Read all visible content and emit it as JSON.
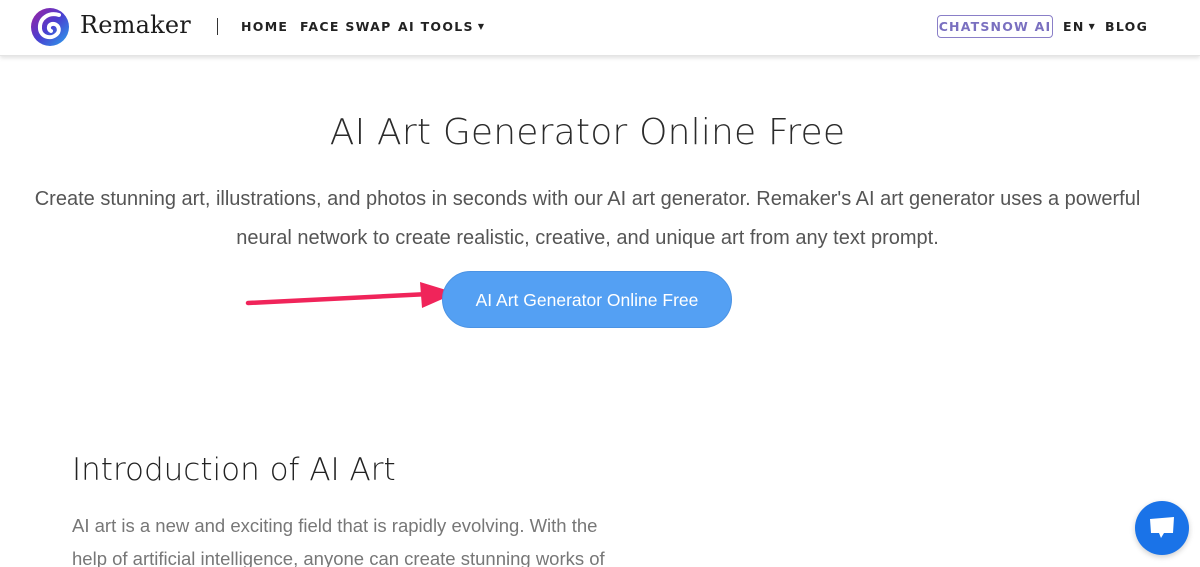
{
  "header": {
    "brand": "Remaker",
    "logo_icon": "remaker-swirl-logo",
    "nav": [
      {
        "label": "HOME"
      },
      {
        "label": "FACE SWAP"
      },
      {
        "label": "AI TOOLS",
        "has_dropdown": true
      }
    ],
    "chatsnow_label": "CHATSNOW AI",
    "language": "EN",
    "blog_label": "BLOG"
  },
  "hero": {
    "title": "AI Art Generator Online Free",
    "subtitle": "Create stunning art, illustrations, and photos in seconds with our AI art generator. Remaker's AI art generator uses a powerful neural network to create realistic, creative, and unique art from any text prompt.",
    "cta_label": "AI Art Generator Online Free"
  },
  "intro": {
    "heading": "Introduction of AI Art",
    "text": "AI art is a new and exciting field that is rapidly evolving. With the help of artificial intelligence, anyone can create stunning works of"
  },
  "colors": {
    "cta_bg": "#54a0f3",
    "accent_purple": "#7a70c0",
    "arrow": "#f0245a",
    "chat_bubble": "#1a73e8"
  },
  "icons": {
    "chat": "chat-bubble-icon",
    "annotation": "red-arrow-annotation"
  }
}
